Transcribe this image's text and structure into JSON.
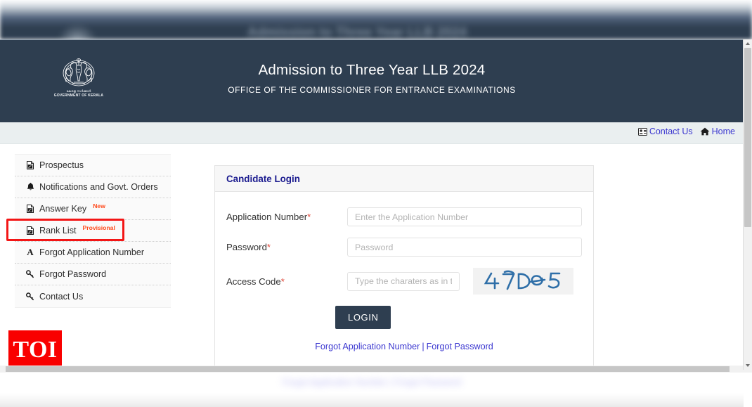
{
  "header": {
    "title": "Admission to Three Year LLB 2024",
    "subtitle": "OFFICE OF THE COMMISSIONER FOR ENTRANCE EXAMINATIONS",
    "emblem": {
      "malayalam_caption": "കേരള സർക്കാർ",
      "english_caption": "GOVERNMENT OF KERALA",
      "icon": "kerala-state-emblem"
    },
    "background_color": "#2e3e50"
  },
  "topnav": {
    "links": [
      {
        "label": "Contact Us",
        "icon": "id-card-icon"
      },
      {
        "label": "Home",
        "icon": "home-icon"
      }
    ],
    "link_color": "#3b37d0",
    "background_color": "#eaeff0"
  },
  "sidebar": {
    "items": [
      {
        "label": "Prospectus",
        "icon": "pdf-file-icon",
        "badge": ""
      },
      {
        "label": "Notifications and Govt. Orders",
        "icon": "bell-icon",
        "badge": ""
      },
      {
        "label": "Answer Key",
        "icon": "pdf-file-icon",
        "badge": "New"
      },
      {
        "label": "Rank List",
        "icon": "pdf-file-icon",
        "badge": "Provisional"
      },
      {
        "label": "Forgot Application Number",
        "icon": "letter-a-icon",
        "badge": ""
      },
      {
        "label": "Forgot Password",
        "icon": "key-icon",
        "badge": ""
      },
      {
        "label": "Contact Us",
        "icon": "key-icon",
        "badge": ""
      }
    ],
    "badge_color": "#ff4a1c"
  },
  "annotation": {
    "target": "Rank List",
    "color": "#f31616",
    "shape": "rectangle-highlight"
  },
  "login_panel": {
    "title": "Candidate Login",
    "title_color": "#1b1b8f",
    "fields": [
      {
        "label": "Application Number",
        "required_marker": "*",
        "placeholder": "Enter the Application Number",
        "value": "",
        "type": "text"
      },
      {
        "label": "Password",
        "required_marker": "*",
        "placeholder": "Password",
        "value": "",
        "type": "password"
      },
      {
        "label": "Access Code",
        "required_marker": "*",
        "placeholder": "Type the charaters as in t",
        "value": "",
        "type": "text"
      }
    ],
    "captcha": {
      "text": "47D65",
      "color": "#2f6fa8",
      "background": "#f2f2f2"
    },
    "submit_label": "LOGIN",
    "submit_color": "#2e3e50",
    "footer_links": [
      {
        "label": "Forgot Application Number"
      },
      {
        "label": "Forgot Password"
      }
    ],
    "footer_separator": "|"
  },
  "watermark": {
    "label": "TOI",
    "background_color": "#f90000",
    "text_color": "#ffffff"
  }
}
